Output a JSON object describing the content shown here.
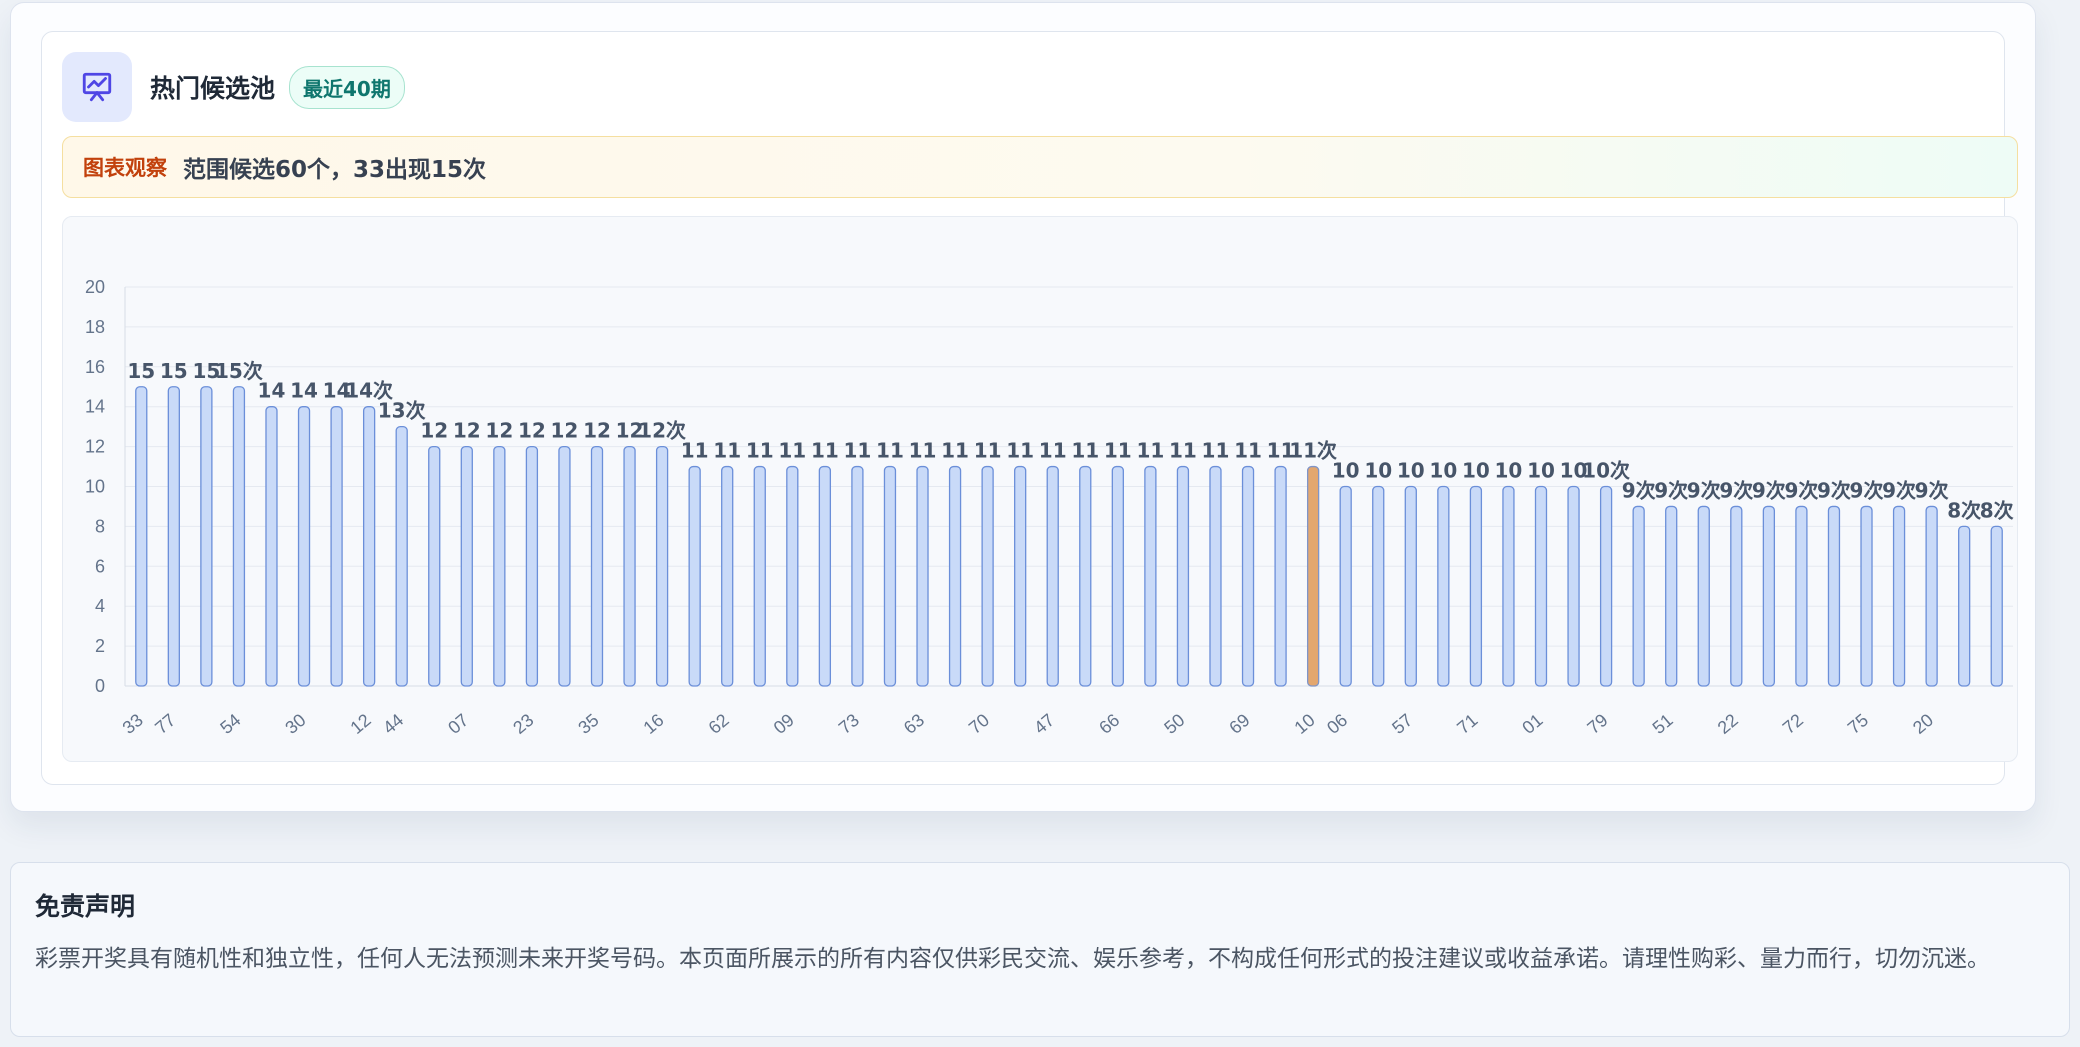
{
  "header": {
    "title": "热门候选池",
    "badge": "最近40期",
    "icon": "chart-presentation-icon"
  },
  "observation": {
    "label": "图表观察",
    "text": "范围候选60个，33出现15次"
  },
  "colors": {
    "bar_fill": "#c9daf8",
    "bar_stroke": "#6b8fd9",
    "highlight_fill": "#e3a76f",
    "highlight_stroke": "#8095c8",
    "label": "#475569",
    "axis_text": "#64748b",
    "grid": "#e5e9f0"
  },
  "chart_data": {
    "type": "bar",
    "title": "",
    "xlabel": "",
    "ylabel": "",
    "ylim": [
      0,
      20
    ],
    "yticks": [
      0,
      2,
      4,
      6,
      8,
      10,
      12,
      14,
      16,
      18,
      20
    ],
    "grid": true,
    "categories": [
      "33",
      "77",
      "",
      "54",
      "",
      "30",
      "",
      "12",
      "44",
      "",
      "07",
      "",
      "23",
      "",
      "35",
      "",
      "16",
      "",
      "62",
      "",
      "09",
      "",
      "73",
      "",
      "63",
      "",
      "70",
      "",
      "47",
      "",
      "66",
      "",
      "50",
      "",
      "69",
      "",
      "10",
      "06",
      "",
      "57",
      "",
      "71",
      "",
      "01",
      "",
      "79",
      "",
      "51",
      "",
      "22",
      "",
      "72",
      "",
      "75",
      "",
      "20",
      ""
    ],
    "values": [
      15,
      15,
      15,
      15,
      14,
      14,
      14,
      14,
      13,
      12,
      12,
      12,
      12,
      12,
      12,
      12,
      12,
      11,
      11,
      11,
      11,
      11,
      11,
      11,
      11,
      11,
      11,
      11,
      11,
      11,
      11,
      11,
      11,
      11,
      11,
      11,
      11,
      10,
      10,
      10,
      10,
      10,
      10,
      10,
      10,
      10,
      9,
      9,
      9,
      9,
      9,
      9,
      9,
      9,
      9,
      9,
      8,
      8
    ],
    "value_labels": [
      "15",
      "15",
      "15",
      "15次",
      "14",
      "14",
      "14",
      "14次",
      "13次",
      "12",
      "12",
      "12",
      "12",
      "12",
      "12",
      "12",
      "12次",
      "11",
      "11",
      "11",
      "11",
      "11",
      "11",
      "11",
      "11",
      "11",
      "11",
      "11",
      "11",
      "11",
      "11",
      "11",
      "11",
      "11",
      "11",
      "11",
      "11次",
      "10",
      "10",
      "10",
      "10",
      "10",
      "10",
      "10",
      "10",
      "10次",
      "9次",
      "9次",
      "9次",
      "9次",
      "9次",
      "9次",
      "9次",
      "9次",
      "9次",
      "9次",
      "8次",
      "8次"
    ],
    "highlight_index": 36
  },
  "disclaimer": {
    "title": "免责声明",
    "text": "彩票开奖具有随机性和独立性，任何人无法预测未来开奖号码。本页面所展示的所有内容仅供彩民交流、娱乐参考，不构成任何形式的投注建议或收益承诺。请理性购彩、量力而行，切勿沉迷。"
  }
}
